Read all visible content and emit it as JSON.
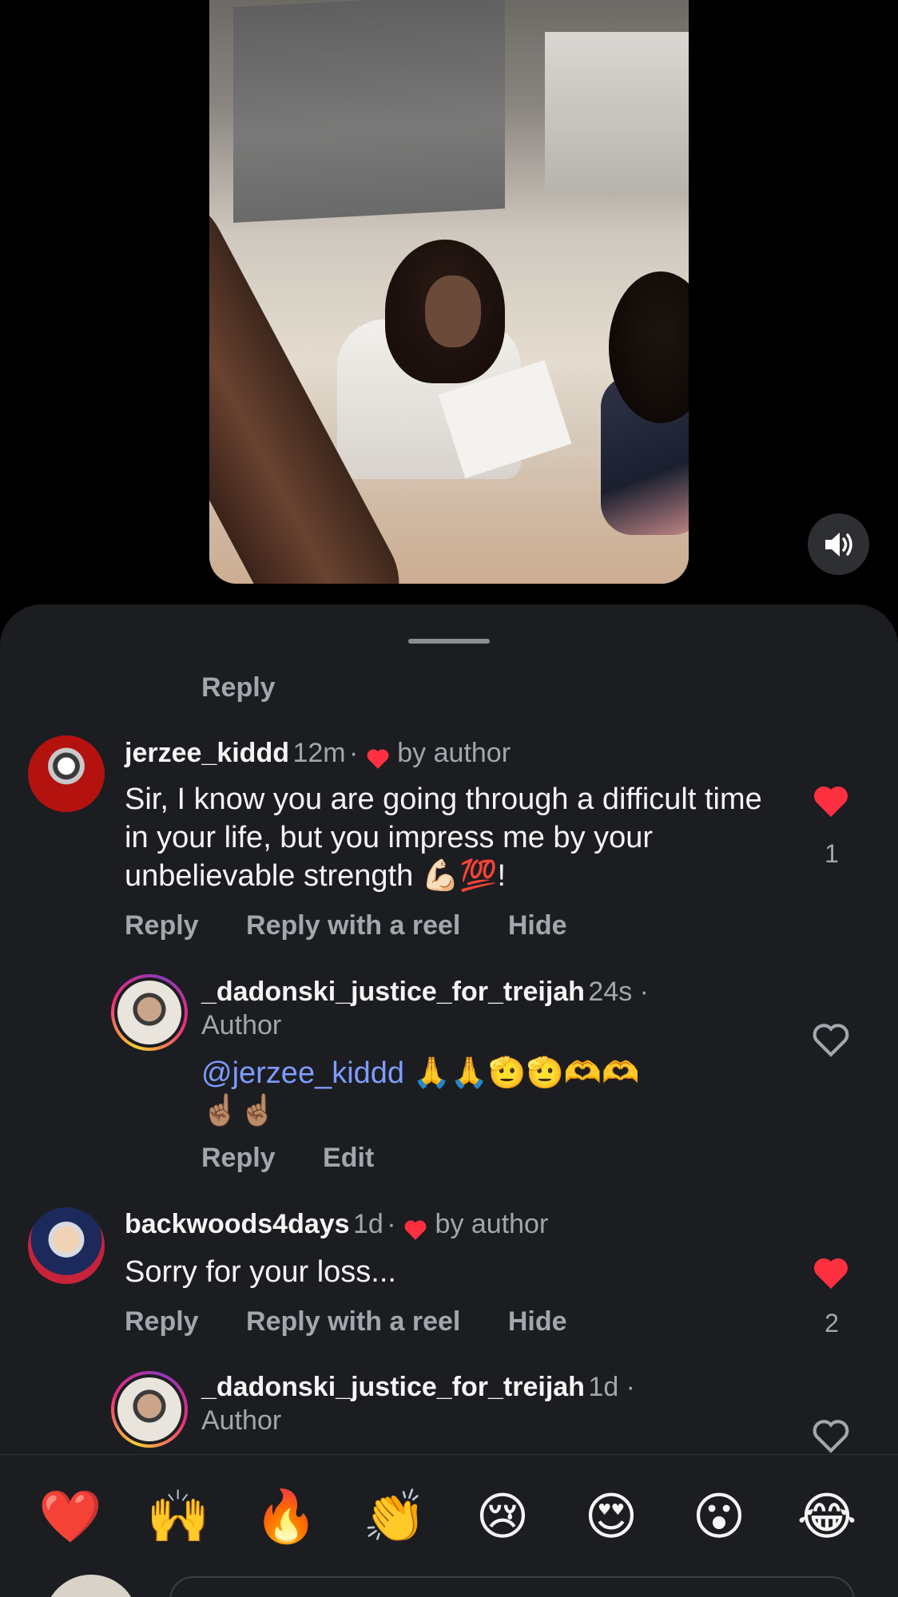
{
  "video": {
    "mute_icon": "speaker-icon"
  },
  "sheet": {
    "top_reply_label": "Reply",
    "comments": [
      {
        "username": "jerzee_kiddd",
        "time": "12m",
        "sep": "·",
        "liked_by": "by author",
        "text": "Sir, I know you are going through a difficult time in your life, but you impress me by your unbelievable strength 💪🏻💯!",
        "likes": "1",
        "reply_label": "Reply",
        "reply_reel_label": "Reply with a reel",
        "hide_label": "Hide"
      },
      {
        "username": "_dadonski_justice_for_treijah",
        "time": "24s ·",
        "role": "Author",
        "mention": "@jerzee_kiddd",
        "text_emoji": " 🙏🙏🫡🫡🫶🫶",
        "text_emoji2": "☝🏽☝🏽",
        "reply_label": "Reply",
        "edit_label": "Edit"
      },
      {
        "username": "backwoods4days",
        "time": "1d",
        "sep": "·",
        "liked_by": "by author",
        "text": "Sorry for your loss...",
        "likes": "2",
        "reply_label": "Reply",
        "reply_reel_label": "Reply with a reel",
        "hide_label": "Hide"
      },
      {
        "username": "_dadonski_justice_for_treijah",
        "time": "1d ·",
        "role": "Author"
      }
    ]
  },
  "emoji_bar": [
    "❤️",
    "🙌",
    "🔥",
    "👏",
    "😢",
    "😍",
    "😮",
    "😂"
  ],
  "colors": {
    "like_red": "#ff3040",
    "mention_blue": "#7f9bff",
    "sheet_bg": "#1b1d21"
  }
}
